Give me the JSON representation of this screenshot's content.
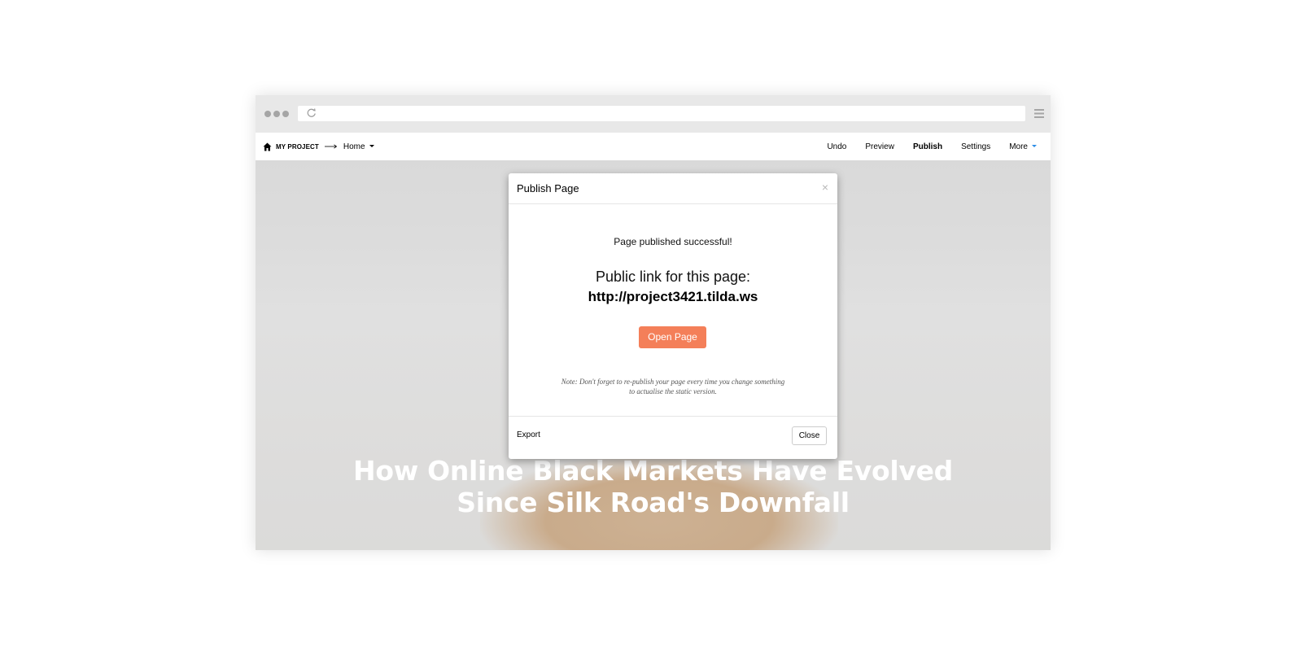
{
  "browser": {
    "url": ""
  },
  "navbar": {
    "project_name": "MY PROJECT",
    "page_name": "Home",
    "items": [
      {
        "label": "Undo",
        "bold": false
      },
      {
        "label": "Preview",
        "bold": false
      },
      {
        "label": "Publish",
        "bold": true
      },
      {
        "label": "Settings",
        "bold": false
      },
      {
        "label": "More",
        "bold": false
      }
    ]
  },
  "hero": {
    "title_line1": "How Online Black Markets Have Evolved",
    "title_line2": "Since Silk Road's Downfall"
  },
  "modal": {
    "title": "Publish Page",
    "close_glyph": "×",
    "success_message": "Page published successful!",
    "link_label": "Public link for this page:",
    "link_url": "http://project3421.tilda.ws",
    "open_button": "Open Page",
    "note_line1": "Note: Don't forget to re-publish your page every time you change something",
    "note_line2": "to actualise the static version.",
    "export_label": "Export",
    "close_button": "Close"
  },
  "colors": {
    "accent": "#f47f59",
    "more_caret": "#2b8ce6"
  },
  "icons": [
    "window-dots-icon",
    "reload-icon",
    "hamburger-icon",
    "home-icon",
    "arrow-right-icon",
    "caret-down-icon",
    "close-icon"
  ]
}
